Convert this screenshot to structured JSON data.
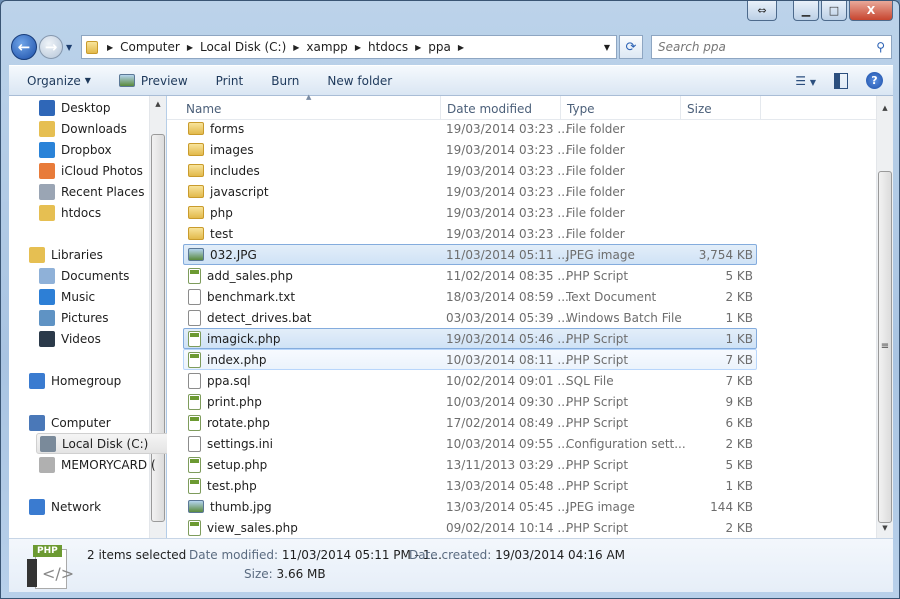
{
  "window": {
    "caption_buttons": [
      "resize",
      "minimize",
      "maximize",
      "close"
    ]
  },
  "address": {
    "crumbs": [
      "Computer",
      "Local Disk (C:)",
      "xampp",
      "htdocs",
      "ppa"
    ]
  },
  "search": {
    "placeholder": "Search ppa"
  },
  "toolbar": {
    "organize": "Organize",
    "preview": "Preview",
    "print": "Print",
    "burn": "Burn",
    "new_folder": "New folder"
  },
  "nav_pane": {
    "favorites": [
      {
        "label": "Desktop",
        "icon": "desktop-icon",
        "color": "#2f67b8"
      },
      {
        "label": "Downloads",
        "icon": "downloads-icon",
        "color": "#e6bf52"
      },
      {
        "label": "Dropbox",
        "icon": "dropbox-icon",
        "color": "#2a83d8"
      },
      {
        "label": "iCloud Photos",
        "icon": "icloud-photos-icon",
        "color": "#e87b3a"
      },
      {
        "label": "Recent Places",
        "icon": "recent-places-icon",
        "color": "#9aa5b4"
      },
      {
        "label": "htdocs",
        "icon": "folder-icon",
        "color": "#e6bf52"
      }
    ],
    "libraries": {
      "label": "Libraries",
      "items": [
        {
          "label": "Documents",
          "icon": "documents-icon",
          "color": "#8fb1d8"
        },
        {
          "label": "Music",
          "icon": "music-icon",
          "color": "#2d7fd6"
        },
        {
          "label": "Pictures",
          "icon": "pictures-icon",
          "color": "#5f93c4"
        },
        {
          "label": "Videos",
          "icon": "videos-icon",
          "color": "#2b3a4a"
        }
      ]
    },
    "homegroup": "Homegroup",
    "computer": {
      "label": "Computer",
      "items": [
        {
          "label": "Local Disk (C:)",
          "icon": "local-disk-icon",
          "color": "#7a8a9a",
          "selected": true
        },
        {
          "label": "MEMORYCARD (",
          "icon": "memorycard-icon",
          "color": "#b0b0b0"
        }
      ]
    },
    "network": "Network"
  },
  "columns": {
    "name": "Name",
    "date": "Date modified",
    "type": "Type",
    "size": "Size",
    "sort": "name-ascending"
  },
  "files": [
    {
      "name": "forms",
      "date": "19/03/2014 03:23 ...",
      "type": "File folder",
      "size": "",
      "kind": "folder"
    },
    {
      "name": "images",
      "date": "19/03/2014 03:23 ...",
      "type": "File folder",
      "size": "",
      "kind": "folder"
    },
    {
      "name": "includes",
      "date": "19/03/2014 03:23 ...",
      "type": "File folder",
      "size": "",
      "kind": "folder"
    },
    {
      "name": "javascript",
      "date": "19/03/2014 03:23 ...",
      "type": "File folder",
      "size": "",
      "kind": "folder"
    },
    {
      "name": "php",
      "date": "19/03/2014 03:23 ...",
      "type": "File folder",
      "size": "",
      "kind": "folder"
    },
    {
      "name": "test",
      "date": "19/03/2014 03:23 ...",
      "type": "File folder",
      "size": "",
      "kind": "folder"
    },
    {
      "name": "032.JPG",
      "date": "11/03/2014 05:11 ...",
      "type": "JPEG image",
      "size": "3,754 KB",
      "kind": "img",
      "state": "selected"
    },
    {
      "name": "add_sales.php",
      "date": "11/02/2014 08:35 ...",
      "type": "PHP Script",
      "size": "5 KB",
      "kind": "php"
    },
    {
      "name": "benchmark.txt",
      "date": "18/03/2014 08:59 ...",
      "type": "Text Document",
      "size": "2 KB",
      "kind": "doc"
    },
    {
      "name": "detect_drives.bat",
      "date": "03/03/2014 05:39 ...",
      "type": "Windows Batch File",
      "size": "1 KB",
      "kind": "doc"
    },
    {
      "name": "imagick.php",
      "date": "19/03/2014 05:46 ...",
      "type": "PHP Script",
      "size": "1 KB",
      "kind": "php",
      "state": "selected"
    },
    {
      "name": "index.php",
      "date": "10/03/2014 08:11 ...",
      "type": "PHP Script",
      "size": "7 KB",
      "kind": "php",
      "state": "hover"
    },
    {
      "name": "ppa.sql",
      "date": "10/02/2014 09:01 ...",
      "type": "SQL File",
      "size": "7 KB",
      "kind": "doc"
    },
    {
      "name": "print.php",
      "date": "10/03/2014 09:30 ...",
      "type": "PHP Script",
      "size": "9 KB",
      "kind": "php"
    },
    {
      "name": "rotate.php",
      "date": "17/02/2014 08:49 ...",
      "type": "PHP Script",
      "size": "6 KB",
      "kind": "php"
    },
    {
      "name": "settings.ini",
      "date": "10/03/2014 09:55 ...",
      "type": "Configuration sett...",
      "size": "2 KB",
      "kind": "doc"
    },
    {
      "name": "setup.php",
      "date": "13/11/2013 03:29 ...",
      "type": "PHP Script",
      "size": "5 KB",
      "kind": "php"
    },
    {
      "name": "test.php",
      "date": "13/03/2014 05:48 ...",
      "type": "PHP Script",
      "size": "1 KB",
      "kind": "php"
    },
    {
      "name": "thumb.jpg",
      "date": "13/03/2014 05:45 ...",
      "type": "JPEG image",
      "size": "144 KB",
      "kind": "img"
    },
    {
      "name": "view_sales.php",
      "date": "09/02/2014 10:14 ...",
      "type": "PHP Script",
      "size": "2 KB",
      "kind": "php"
    }
  ],
  "status": {
    "count": "2 items selected",
    "date_modified_label": "Date modified:",
    "date_modified": "11/03/2014 05:11 PM - 1...",
    "date_created_label": "Date created:",
    "date_created": "19/03/2014 04:16 AM",
    "size_label": "Size:",
    "size": "3.66 MB",
    "thumb_badge": "PHP"
  }
}
